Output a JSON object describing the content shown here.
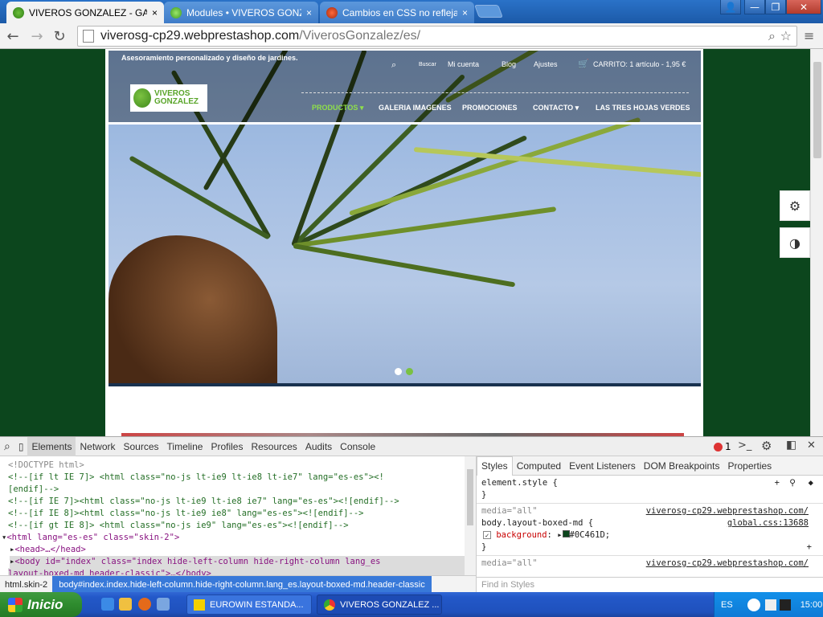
{
  "browser": {
    "tabs": [
      {
        "label": "VIVEROS GONZALEZ - GARD",
        "active": true
      },
      {
        "label": "Modules • VIVEROS GONZAL",
        "active": false
      },
      {
        "label": "Cambios en CSS no reflejado",
        "active": false
      }
    ],
    "tab_close": "×",
    "window_controls": {
      "user": "👤",
      "minimize": "—",
      "maximize": "❐",
      "close": "✕"
    },
    "url_host": "viverosg-cp29.webprestashop.com",
    "url_path": "/ViverosGonzalez/es/",
    "nav": {
      "back": "←",
      "forward": "→",
      "reload": "↻"
    }
  },
  "site": {
    "tagline": "Asesoramiento personalizado y diseño de jardines.",
    "top_links": {
      "search": "Buscar",
      "account": "Mi cuenta",
      "blog": "Blog",
      "settings": "Ajustes",
      "cart": "CARRITO: 1 artículo - 1,95 €"
    },
    "logo_line1": "VIVEROS",
    "logo_line2": "GONZALEZ",
    "menu": [
      {
        "label": "PRODUCTOS ▾",
        "active": true
      },
      {
        "label": "GALERIA IMAGENES",
        "active": false
      },
      {
        "label": "PROMOCIONES",
        "active": false
      },
      {
        "label": "CONTACTO ▾",
        "active": false
      },
      {
        "label": "LAS TRES HOJAS VERDES",
        "active": false
      }
    ],
    "side_buttons": {
      "tools": "⚙",
      "contrast": "◑"
    }
  },
  "devtools": {
    "tabs": [
      "Elements",
      "Network",
      "Sources",
      "Timeline",
      "Profiles",
      "Resources",
      "Audits",
      "Console"
    ],
    "selected_tab": "Elements",
    "error_count": "1",
    "dom_lines": [
      "<!DOCTYPE html>",
      "<!--[if lt IE 7]> <html class=\"no-js lt-ie9 lt-ie8 lt-ie7\" lang=\"es-es\"><!",
      "[endif]-->",
      "<!--[if IE 7]><html class=\"no-js lt-ie9 lt-ie8 ie7\" lang=\"es-es\"><![endif]-->",
      "<!--[if IE 8]><html class=\"no-js lt-ie9 ie8\" lang=\"es-es\"><![endif]-->",
      "<!--[if gt IE 8]> <html class=\"no-js ie9\" lang=\"es-es\"><![endif]-->",
      "<html lang=\"es-es\" class=\"skin-2\">",
      "<head>…</head>",
      "<body id=\"index\" class=\"index hide-left-column hide-right-column lang_es",
      "layout-boxed-md   header-classic\">…</body>"
    ],
    "breadcrumb": [
      "html.skin-2",
      "body#index.index.hide-left-column.hide-right-column.lang_es.layout-boxed-md.header-classic"
    ],
    "styles_tabs": [
      "Styles",
      "Computed",
      "Event Listeners",
      "DOM Breakpoints",
      "Properties"
    ],
    "styles": {
      "element_style": "element.style {",
      "close_brace": "}",
      "rule1_media": "media=\"all\"",
      "rule1_source": "viverosg-cp29.webprestashop.com/",
      "rule1_file": "global.css:13688",
      "rule1_selector": "body.layout-boxed-md {",
      "rule1_prop": "background",
      "rule1_value": "#0C461D;",
      "rule2_media": "media=\"all\"",
      "rule2_source": "viverosg-cp29.webprestashop.com/"
    },
    "find_placeholder": "Find in Styles"
  },
  "taskbar": {
    "start": "Inicio",
    "tasks": [
      "EUROWIN ESTANDA...",
      "VIVEROS GONZALEZ ..."
    ],
    "lang": "ES",
    "clock": "15:00"
  },
  "colors": {
    "site_bg": "#0C461D",
    "menu_active": "#8fe04a"
  }
}
